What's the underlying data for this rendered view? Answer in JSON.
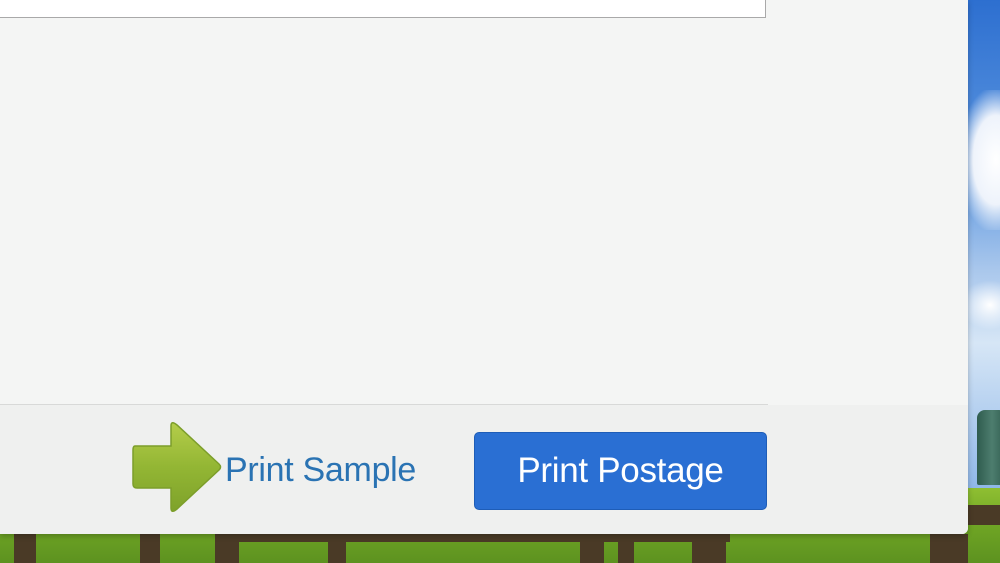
{
  "footer": {
    "print_sample_label": "Print Sample",
    "print_postage_label": "Print Postage",
    "arrow_icon": "right-arrow-icon"
  },
  "colors": {
    "link": "#2a73b3",
    "primary_button": "#2a6fd3",
    "arrow": "#93b634",
    "panel": "#f4f5f4"
  }
}
